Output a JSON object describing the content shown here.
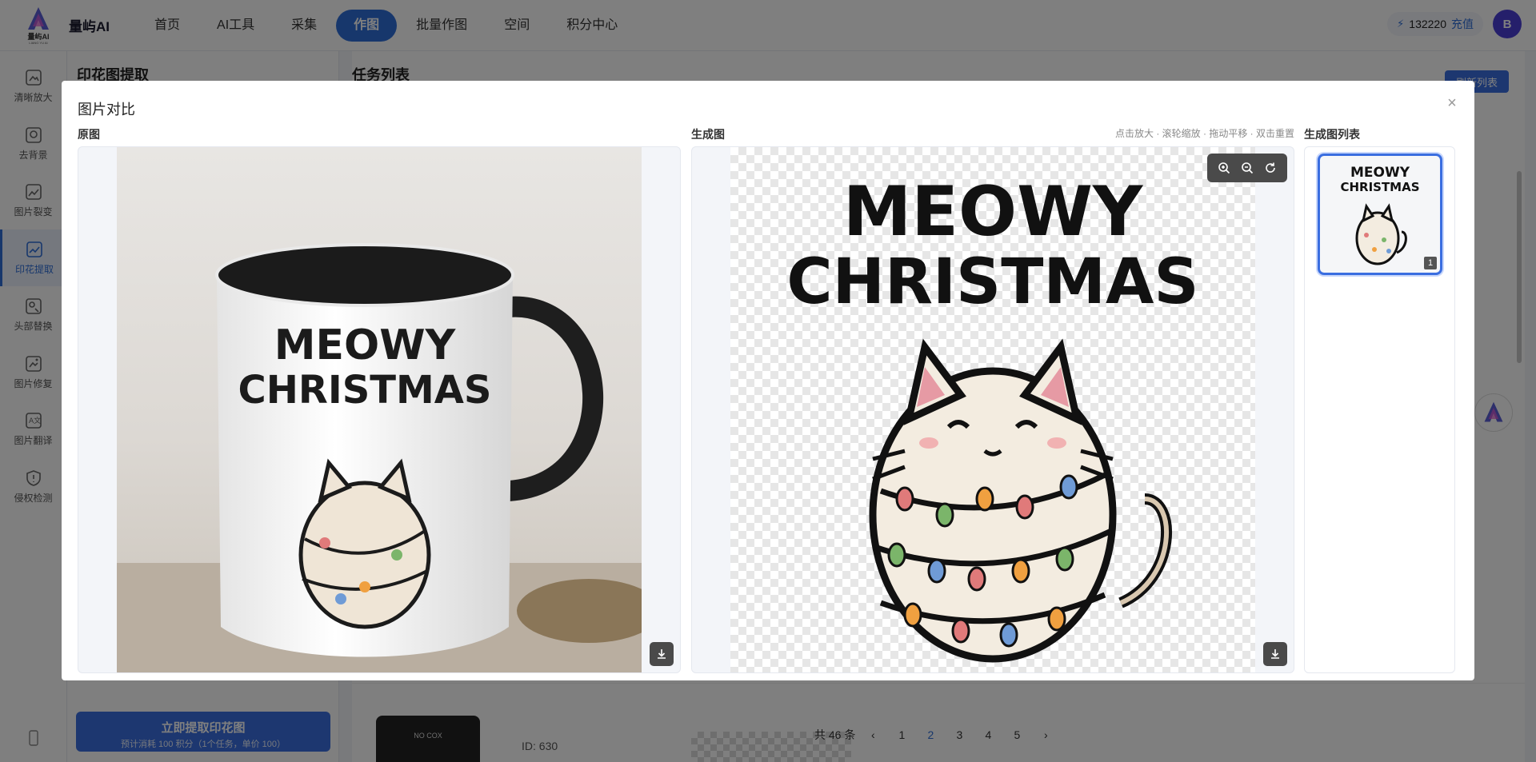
{
  "app": {
    "brand": "量屿AI",
    "logo_text": "量屿AI",
    "logo_sub": "LIANG YU AI"
  },
  "nav": {
    "items": [
      {
        "label": "首页"
      },
      {
        "label": "AI工具"
      },
      {
        "label": "采集"
      },
      {
        "label": "作图",
        "active": true
      },
      {
        "label": "批量作图"
      },
      {
        "label": "空间"
      },
      {
        "label": "积分中心"
      }
    ],
    "points": "132220",
    "recharge": "充值",
    "avatar": "B"
  },
  "sidebar": {
    "items": [
      {
        "label": "清晰放大",
        "icon": "image-enlarge-icon"
      },
      {
        "label": "去背景",
        "icon": "remove-bg-icon"
      },
      {
        "label": "图片裂变",
        "icon": "image-fission-icon"
      },
      {
        "label": "印花提取",
        "icon": "print-extract-icon",
        "active": true
      },
      {
        "label": "头部替换",
        "icon": "head-swap-icon"
      },
      {
        "label": "图片修复",
        "icon": "image-repair-icon"
      },
      {
        "label": "图片翻译",
        "icon": "image-translate-icon"
      },
      {
        "label": "侵权检测",
        "icon": "infringement-check-icon"
      }
    ]
  },
  "left_panel": {
    "title": "印花图提取",
    "extract_button": "立即提取印花图",
    "extract_note": "预计消耗 100 积分（1个任务，单价 100）"
  },
  "task_panel": {
    "title": "任务列表",
    "refresh": "刷新列表",
    "task_id": "ID: 630",
    "thumb_text": "NO COX",
    "pagination": {
      "total": "共 46 条",
      "pages": [
        "1",
        "2",
        "3",
        "4",
        "5"
      ],
      "current": "2"
    }
  },
  "modal": {
    "title": "图片对比",
    "original_label": "原图",
    "generated_label": "生成图",
    "hint": "点击放大 · 滚轮缩放 · 拖动平移 · 双击重置",
    "list_label": "生成图列表",
    "thumb_badge": "1",
    "print_line1": "MEOWY",
    "print_line2": "CHRISTMAS"
  }
}
